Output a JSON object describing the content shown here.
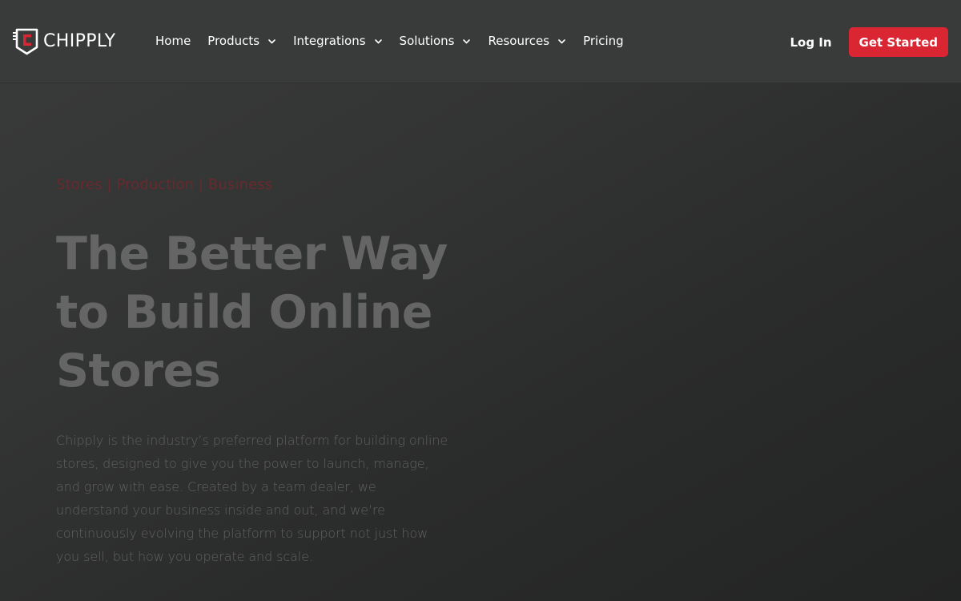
{
  "brand": {
    "name": "CHIPPLY",
    "accent_color": "#d92632"
  },
  "nav": {
    "items": [
      {
        "label": "Home",
        "has_dropdown": false
      },
      {
        "label": "Products",
        "has_dropdown": true
      },
      {
        "label": "Integrations",
        "has_dropdown": true
      },
      {
        "label": "Solutions",
        "has_dropdown": true
      },
      {
        "label": "Resources",
        "has_dropdown": true
      },
      {
        "label": "Pricing",
        "has_dropdown": false
      }
    ],
    "dropdown_icon": "chevron-down-icon"
  },
  "header_actions": {
    "login_label": "Log In",
    "cta_label": "Get Started"
  },
  "hero": {
    "eyebrow": "Stores | Production | Business",
    "title_lines": [
      "The Better Way",
      "to Build Online",
      "Stores"
    ],
    "description_lines": [
      "Chipply is the industry’s preferred platform for building online",
      "stores, designed to give you the power to launch, manage,",
      "and grow with ease. Created by a team dealer, we",
      "understand your business inside and out, and we’re",
      "continuously evolving the platform to support not just how",
      "you sell, but how you operate and scale."
    ]
  },
  "colors": {
    "header_bg": "#393a3a",
    "page_bg": "#2e2f2f",
    "eyebrow": "#672a2e",
    "title": "#646564",
    "description": "#606160"
  }
}
